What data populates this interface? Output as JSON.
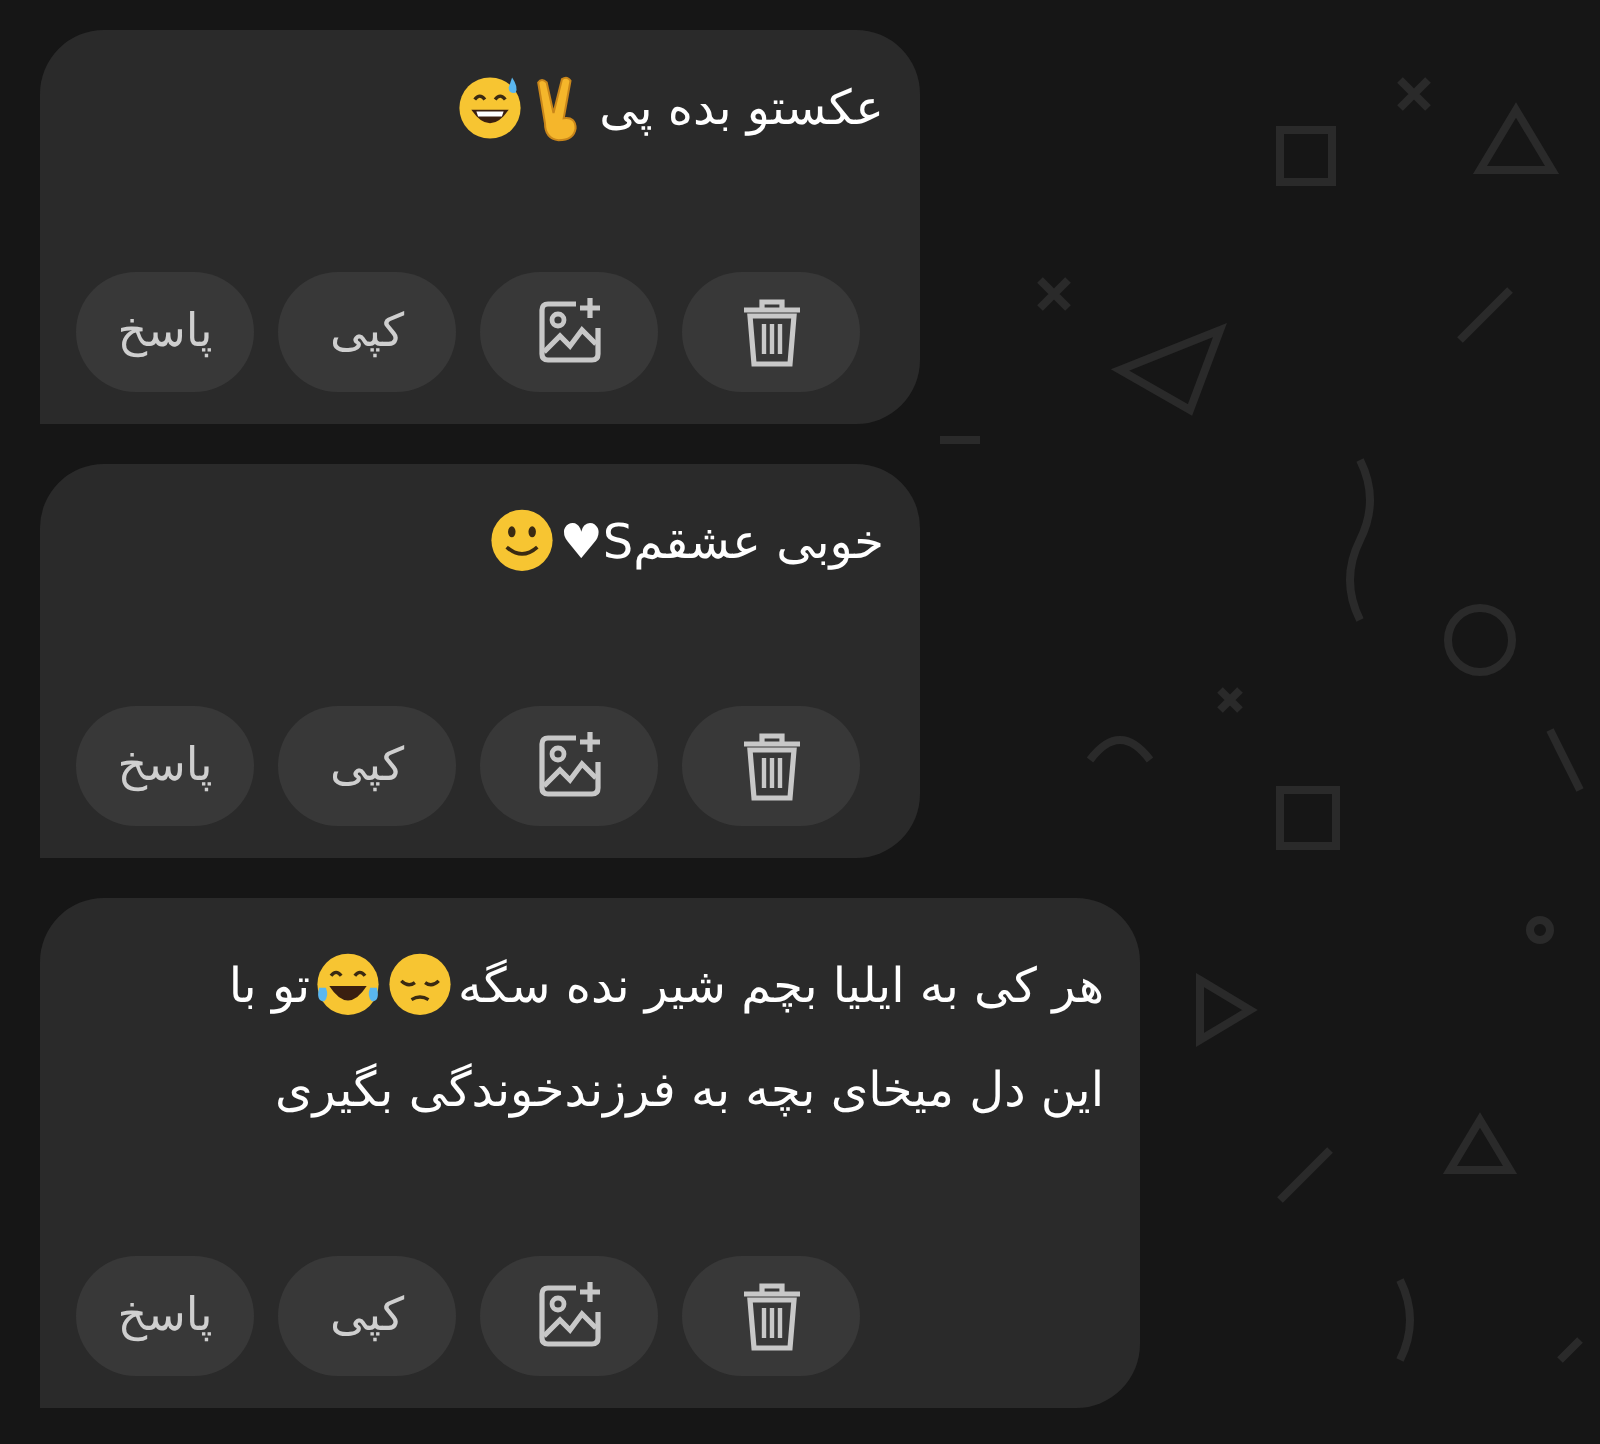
{
  "messages": [
    {
      "lines": [
        [
          {
            "kind": "text",
            "text": "عکستو بده پی"
          },
          {
            "kind": "victory"
          },
          {
            "kind": "grin-sweat"
          }
        ]
      ],
      "actions": [
        {
          "kind": "delete"
        },
        {
          "kind": "add-image"
        },
        {
          "kind": "copy",
          "label": "کپی"
        },
        {
          "kind": "reply",
          "label": "پاسخ"
        }
      ]
    },
    {
      "lines": [
        [
          {
            "kind": "text",
            "text": "خوبی عشقمS♥"
          },
          {
            "kind": "smile"
          }
        ]
      ],
      "actions": [
        {
          "kind": "delete"
        },
        {
          "kind": "add-image"
        },
        {
          "kind": "copy",
          "label": "کپی"
        },
        {
          "kind": "reply",
          "label": "پاسخ"
        }
      ]
    },
    {
      "lines": [
        [
          {
            "kind": "text",
            "text": "هر کی به ایلیا بچم شیر نده سگه"
          },
          {
            "kind": "pensive"
          },
          {
            "kind": "joy-tears"
          },
          {
            "kind": "text",
            "text": "تو با"
          }
        ],
        [
          {
            "kind": "text",
            "text": "این دل میخای بچه به فرزندخوندگی بگیری"
          }
        ]
      ],
      "actions": [
        {
          "kind": "delete"
        },
        {
          "kind": "add-image"
        },
        {
          "kind": "copy",
          "label": "کپی"
        },
        {
          "kind": "reply",
          "label": "پاسخ"
        }
      ]
    }
  ]
}
